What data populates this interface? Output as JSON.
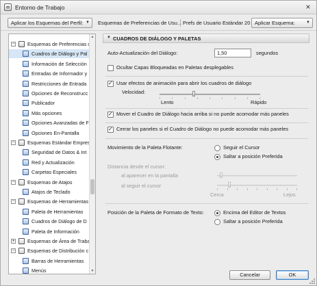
{
  "window": {
    "title": "Entorno de Trabajo",
    "close_glyph": "×"
  },
  "toolbar": {
    "apply_profile_label": "Aplicar los Esquemas del Perfil:",
    "scheme_path": "Esquemas de Preferencias de Usu...",
    "scheme_name": "Prefs de Usuario Estándar 20",
    "apply_scheme_label": "Aplicar Esquema:"
  },
  "tree": {
    "items": [
      {
        "label": "Esquemas de Preferencias c",
        "level": 0,
        "expander": "−",
        "icon": "folder-icon"
      },
      {
        "label": "Cuadros de Diálogo y Pal",
        "level": 1,
        "icon": "dialog-icon",
        "selected": true
      },
      {
        "label": "Información de Selección",
        "level": 1,
        "icon": "info-icon"
      },
      {
        "label": "Entradas de Informador y",
        "level": 1,
        "icon": "input-icon"
      },
      {
        "label": "Restricciones de Entrada",
        "level": 1,
        "icon": "constraint-icon"
      },
      {
        "label": "Opciones de Reconstrucc",
        "level": 1,
        "icon": "rebuild-icon"
      },
      {
        "label": "Publicador",
        "level": 1,
        "icon": "publisher-icon"
      },
      {
        "label": "Más opciones",
        "level": 1,
        "icon": "more-options-icon"
      },
      {
        "label": "Opciones Avanzadas de F",
        "level": 1,
        "icon": "advanced-icon"
      },
      {
        "label": "Opciones En-Pantalla",
        "level": 1,
        "icon": "screen-icon"
      },
      {
        "label": "Esquemas Estándar Empres",
        "level": 0,
        "expander": "−",
        "icon": "folder-icon"
      },
      {
        "label": "Seguridad de Datos & Int",
        "level": 1,
        "icon": "security-icon"
      },
      {
        "label": "Red y Actualización",
        "level": 1,
        "icon": "network-icon"
      },
      {
        "label": "Carpetas Especiales",
        "level": 1,
        "icon": "folders-icon"
      },
      {
        "label": "Esquemas de Atajos",
        "level": 0,
        "expander": "−",
        "icon": "folder-icon"
      },
      {
        "label": "Atajos de Teclado",
        "level": 1,
        "icon": "keyboard-icon"
      },
      {
        "label": "Esquemas de Herramientas",
        "level": 0,
        "expander": "−",
        "icon": "folder-icon"
      },
      {
        "label": "Paleta de Herramientas",
        "level": 1,
        "icon": "toolbox-icon"
      },
      {
        "label": "Cuadros de Diálogo de D",
        "level": 1,
        "icon": "dialog-icon"
      },
      {
        "label": "Paleta de Información",
        "level": 1,
        "icon": "info-palette-icon"
      },
      {
        "label": "Esquemas de Área de Trabaj",
        "level": 0,
        "expander": "+",
        "icon": "folder-icon"
      },
      {
        "label": "Esquemas de Distribución c",
        "level": 0,
        "expander": "−",
        "icon": "folder-icon"
      },
      {
        "label": "Barras de Herramientas",
        "level": 1,
        "icon": "toolbars-icon"
      },
      {
        "label": "Menús",
        "level": 1,
        "icon": "menus-icon"
      }
    ]
  },
  "panel": {
    "section_title": "CUADROS DE DIÁLOGO Y PALETAS",
    "auto_update_label": "Auto-Actualización del Diálogo:",
    "auto_update_value": "1,50",
    "auto_update_unit": "segundos",
    "hide_locked_layers_label": "Ocultar Capas Bloqueadas en Paletas desplegables",
    "hide_locked_layers_checked": false,
    "animation_label": "Usar efectos de animación para abrir los cuadros de diálogo",
    "animation_checked": true,
    "speed_label": "Velocidad:",
    "speed_slow": "Lento",
    "speed_fast": "Rápido",
    "speed_level": 0.34,
    "move_dialog_label": "Mover el Cuadro de Diálogo hacia arriba si no puede acomodar más paneles",
    "move_dialog_checked": true,
    "close_panels_label": "Cerrar los paneles si el Cuadro de Diálogo no puede acomodar más paneles",
    "close_panels_checked": true,
    "floating_palette_label": "Movimiento de la Paleta Flotante:",
    "follow_cursor_label": "Seguir el Cursor",
    "jump_preferred_label": "Saltar a posición Preferida",
    "floating_palette_choice": "jump_preferred",
    "cursor_distance_label": "Distancia desde el cursor:",
    "appear_label": "al aparecer en la pantalla",
    "follow_label": "al seguir el cursor",
    "near_label": "Cerca",
    "far_label": "Lejos",
    "appear_level": 0.05,
    "follow_level": 0.15,
    "text_format_palette_label": "Posición de la Paleta de Formato de Texto:",
    "above_editor_label": "Encima del Editor de Textos",
    "jump_preferred_label_2": "Saltar a posición Preferida",
    "text_format_choice": "above_editor"
  },
  "footer": {
    "cancel_label": "Cancelar",
    "ok_label": "OK"
  },
  "colors": {
    "selection": "#d6e6f6",
    "default_button_border": "#3c7fc1"
  }
}
